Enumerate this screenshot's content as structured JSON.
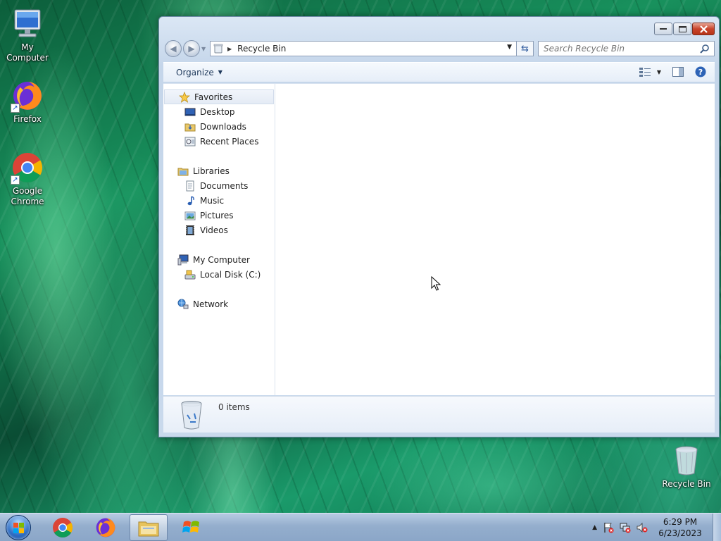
{
  "desktop": {
    "icons": [
      {
        "label": "My Computer",
        "icon": "computer-icon"
      },
      {
        "label": "Firefox",
        "icon": "firefox-icon"
      },
      {
        "label": "Google Chrome",
        "icon": "chrome-icon"
      },
      {
        "label": "Recycle Bin",
        "icon": "recycle-bin-icon"
      }
    ]
  },
  "window": {
    "address": {
      "location": "Recycle Bin"
    },
    "search": {
      "placeholder": "Search Recycle Bin"
    },
    "toolbar": {
      "organize_label": "Organize"
    },
    "nav_pane": {
      "favorites": {
        "label": "Favorites",
        "items": [
          "Desktop",
          "Downloads",
          "Recent Places"
        ]
      },
      "libraries": {
        "label": "Libraries",
        "items": [
          "Documents",
          "Music",
          "Pictures",
          "Videos"
        ]
      },
      "computer": {
        "label": "My Computer",
        "items": [
          "Local Disk (C:)"
        ]
      },
      "network": {
        "label": "Network"
      }
    },
    "status": {
      "item_count": "0 items"
    }
  },
  "taskbar": {
    "clock": {
      "time": "6:29 PM",
      "date": "6/23/2023"
    }
  },
  "colors": {
    "accent": "#2c6cc4",
    "close_button": "#c9442b",
    "selection": "#e4ebf5"
  }
}
